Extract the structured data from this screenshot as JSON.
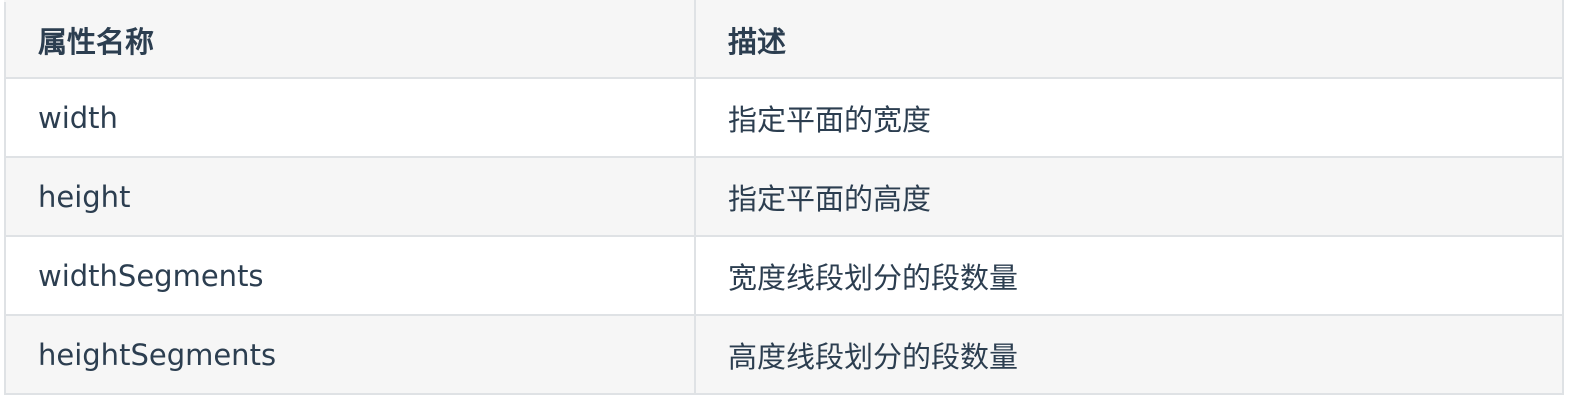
{
  "table": {
    "headers": [
      "属性名称",
      "描述"
    ],
    "rows": [
      {
        "name": "width",
        "desc": "指定平面的宽度"
      },
      {
        "name": "height",
        "desc": "指定平面的高度"
      },
      {
        "name": "widthSegments",
        "desc": "宽度线段划分的段数量"
      },
      {
        "name": "heightSegments",
        "desc": "高度线段划分的段数量"
      }
    ]
  },
  "colors": {
    "text": "#2c3e50",
    "border": "#dfe2e5",
    "stripe": "#f6f6f6",
    "background": "#ffffff"
  }
}
